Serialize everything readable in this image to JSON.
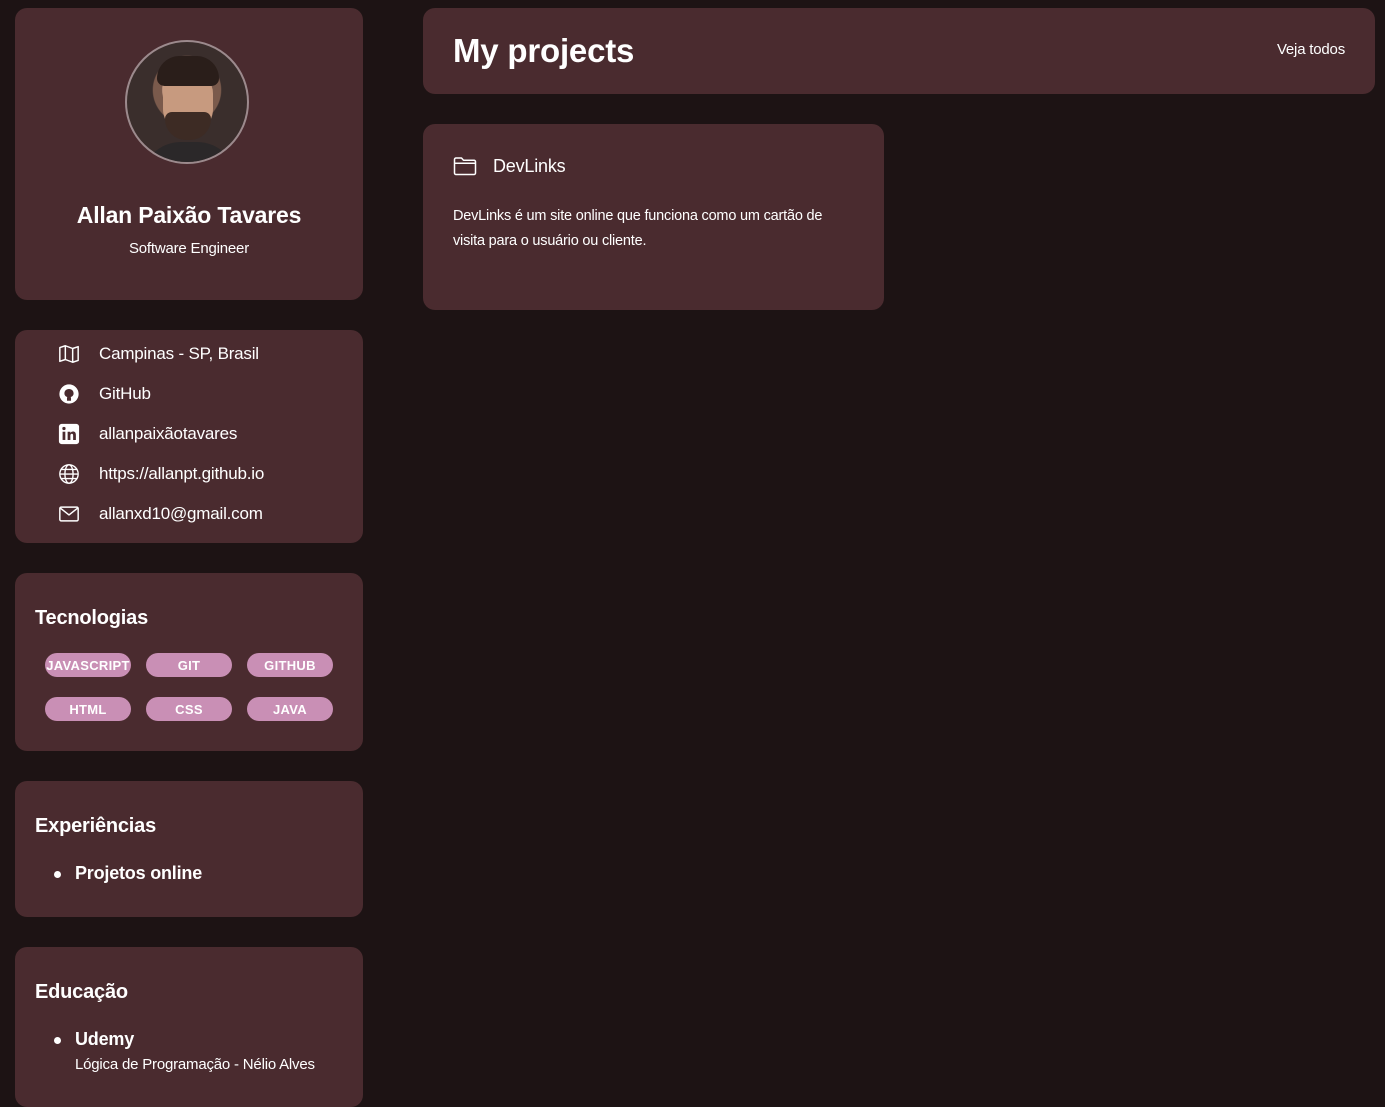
{
  "profile": {
    "name": "Allan Paixão Tavares",
    "role": "Software Engineer"
  },
  "contacts": [
    {
      "icon": "map-icon",
      "text": "Campinas - SP, Brasil"
    },
    {
      "icon": "github-icon",
      "text": "GitHub"
    },
    {
      "icon": "linkedin-icon",
      "text": "allanpaixãotavares"
    },
    {
      "icon": "globe-icon",
      "text": "https://allanpt.github.io"
    },
    {
      "icon": "mail-icon",
      "text": "allanxd10@gmail.com"
    }
  ],
  "technologies": {
    "title": "Tecnologias",
    "tags": [
      "JAVASCRIPT",
      "GIT",
      "GITHUB",
      "HTML",
      "CSS",
      "JAVA"
    ]
  },
  "experiences": {
    "title": "Experiências",
    "items": [
      {
        "title": "Projetos online"
      }
    ]
  },
  "education": {
    "title": "Educação",
    "items": [
      {
        "title": "Udemy",
        "subtitle": "Lógica de Programação - Nélio Alves"
      }
    ]
  },
  "header": {
    "title": "My projects",
    "link": "Veja todos"
  },
  "projects": [
    {
      "icon": "folder-icon",
      "name": "DevLinks",
      "description": "DevLinks é um site online que funciona como um cartão de visita para o usuário ou cliente."
    }
  ],
  "colors": {
    "background": "#1d1314",
    "card": "#4a2b2f",
    "tag": "#c98fb5",
    "text": "#ffffff"
  }
}
